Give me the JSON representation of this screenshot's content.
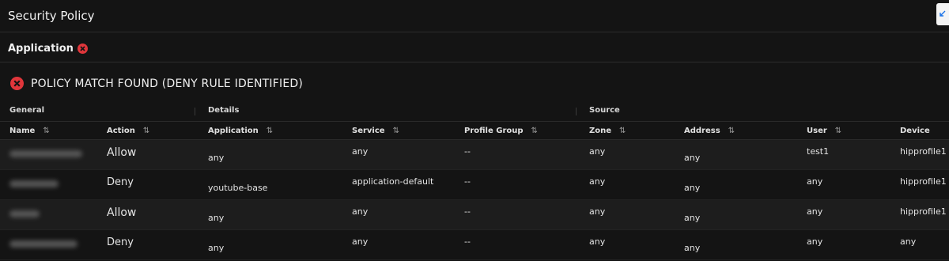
{
  "header": {
    "title": "Security Policy"
  },
  "filter": {
    "label": "Application"
  },
  "status": {
    "message": "POLICY MATCH FOUND (DENY RULE IDENTIFIED)"
  },
  "groups": [
    "General",
    "Details",
    "Source"
  ],
  "columns": [
    "Name",
    "Action",
    "Application",
    "Service",
    "Profile Group",
    "Zone",
    "Address",
    "User",
    "Device"
  ],
  "rows": [
    {
      "action": "Allow",
      "application": "any",
      "service": "any",
      "profile_group": "--",
      "zone": "any",
      "address": "any",
      "user": "test1",
      "device": "hipprofile1"
    },
    {
      "action": "Deny",
      "application": "youtube-base",
      "service": "application-default",
      "profile_group": "--",
      "zone": "any",
      "address": "any",
      "user": "any",
      "device": "hipprofile1"
    },
    {
      "action": "Allow",
      "application": "any",
      "service": "any",
      "profile_group": "--",
      "zone": "any",
      "address": "any",
      "user": "any",
      "device": "hipprofile1"
    },
    {
      "action": "Deny",
      "application": "any",
      "service": "any",
      "profile_group": "--",
      "zone": "any",
      "address": "any",
      "user": "any",
      "device": "any"
    }
  ],
  "colors": {
    "deny_red": "#e0363b",
    "background": "#141414",
    "accent_blue": "#1a73e8"
  },
  "icons": {
    "status": "x-circle-icon",
    "filter_clear": "x-circle-icon",
    "sort": "sort-icon",
    "expand": "expand-icon"
  }
}
